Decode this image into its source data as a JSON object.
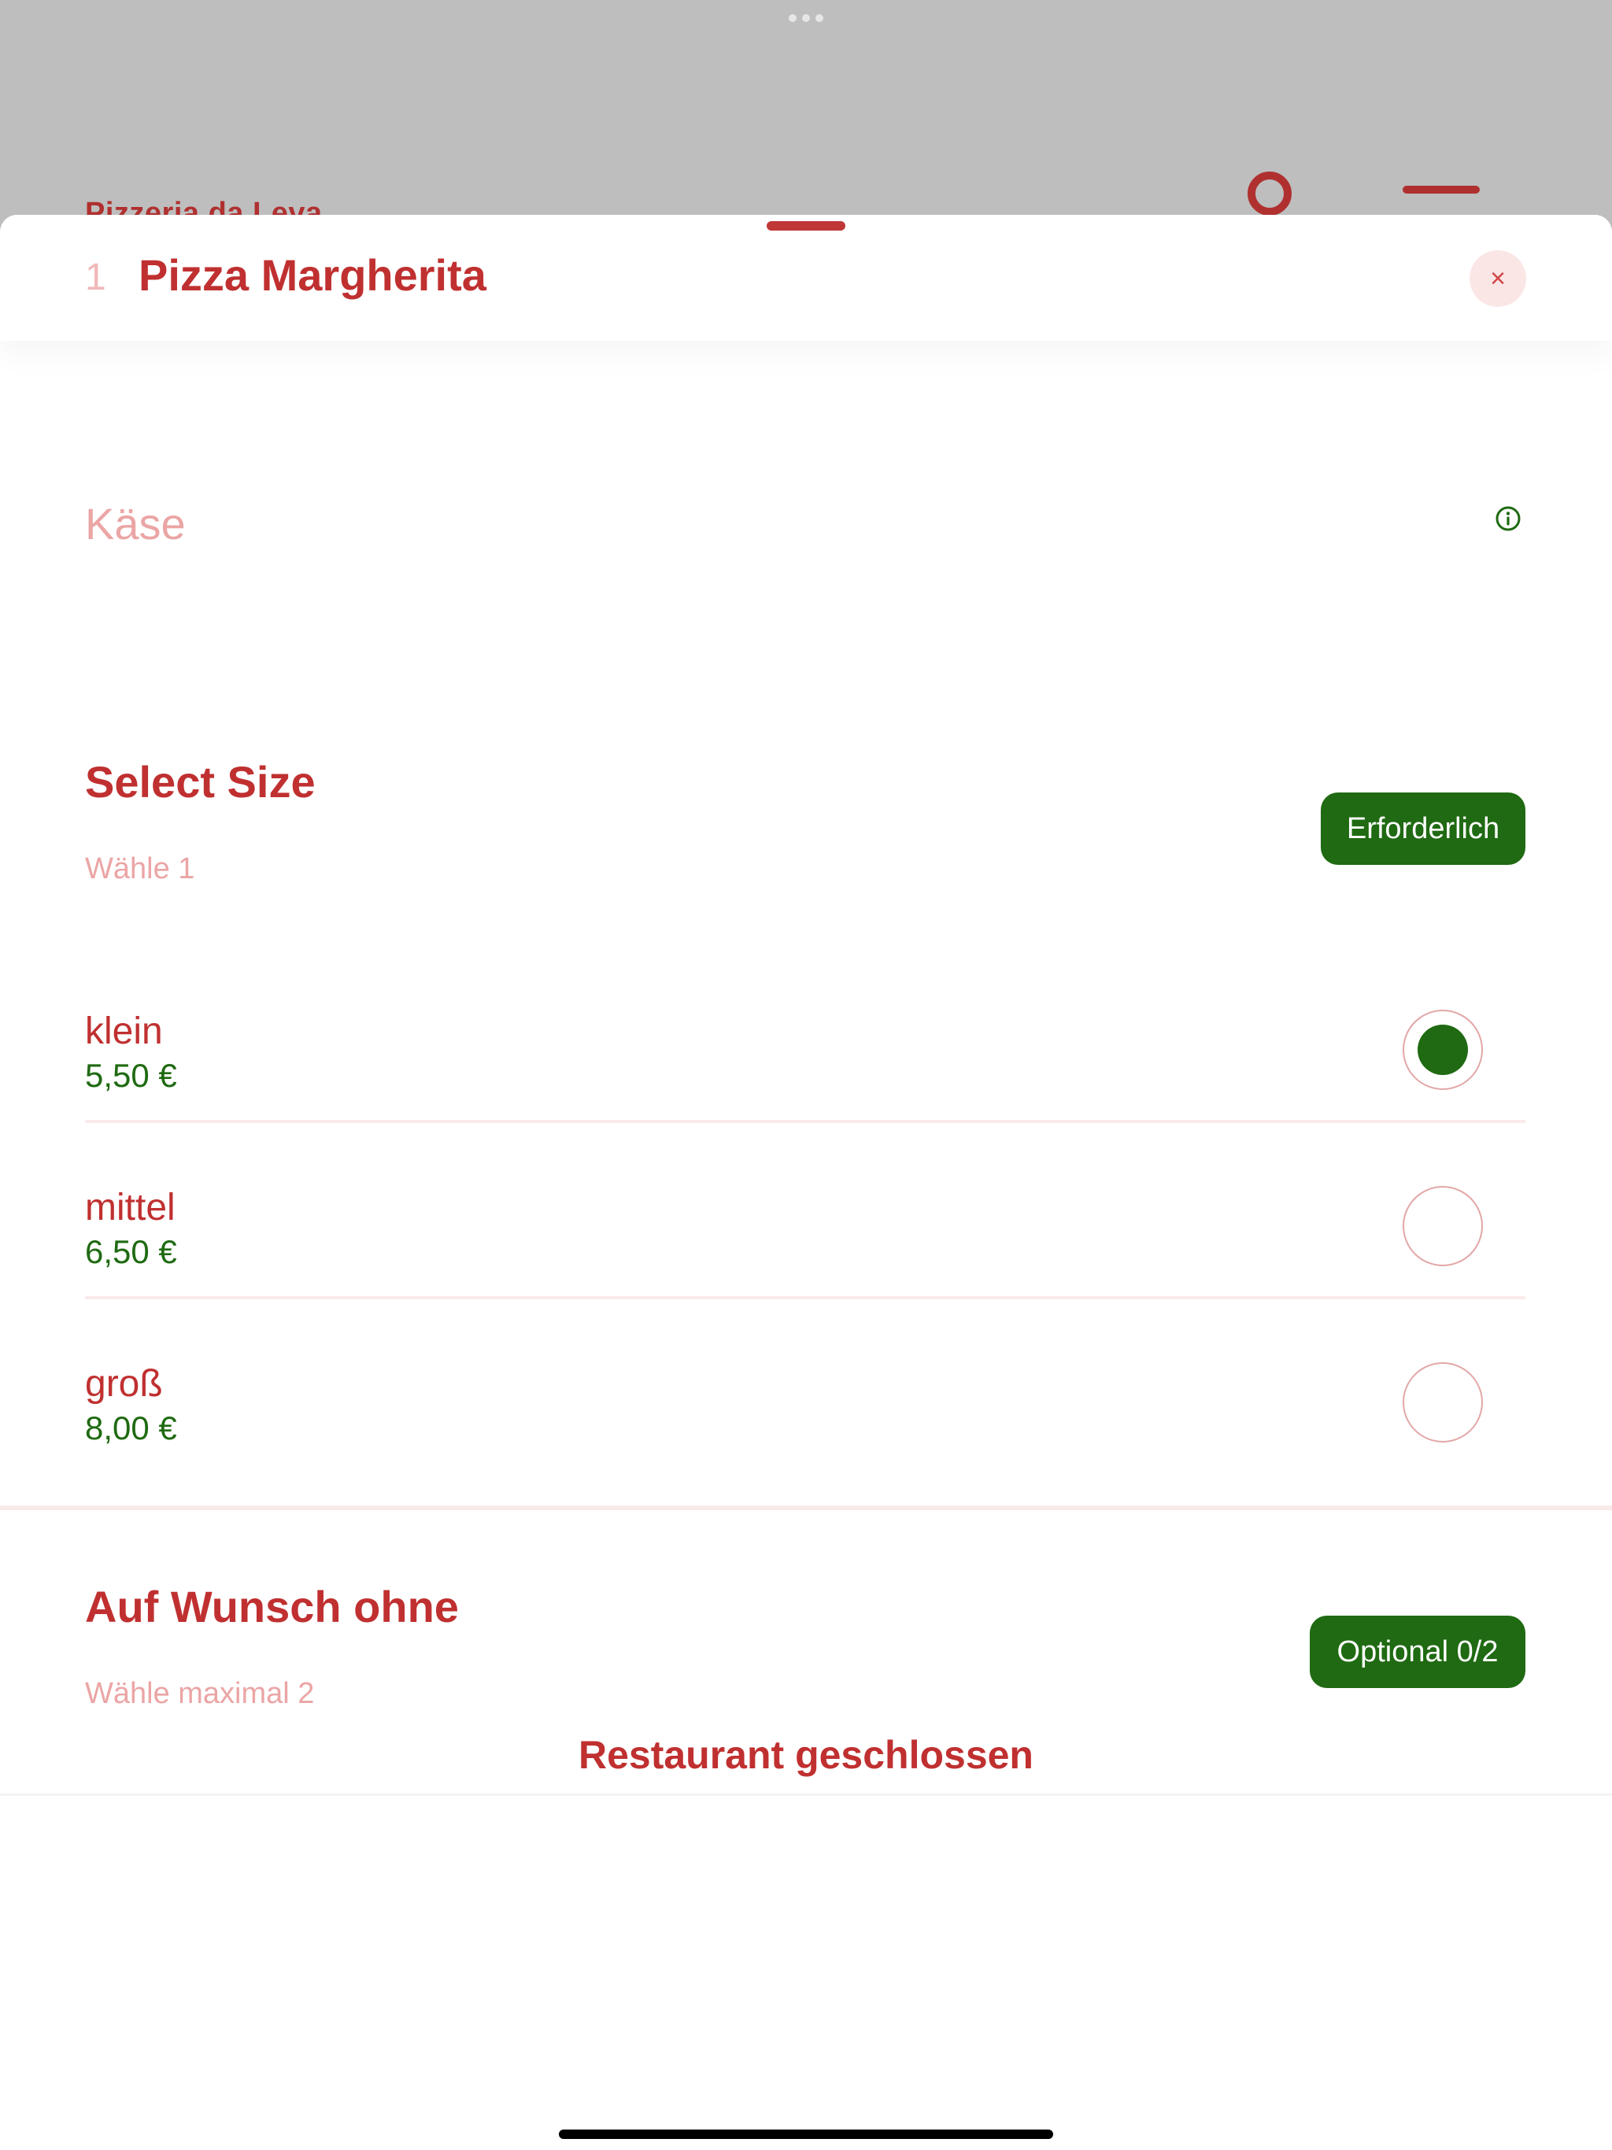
{
  "background": {
    "restaurant_name": "Pizzeria da Leva"
  },
  "header": {
    "item_number": "1",
    "item_title": "Pizza Margherita",
    "close_label": "×"
  },
  "description": "Käse",
  "size_section": {
    "title": "Select Size",
    "subtitle": "Wähle 1",
    "badge": "Erforderlich",
    "options": [
      {
        "name": "klein",
        "price": "5,50 €",
        "selected": true
      },
      {
        "name": "mittel",
        "price": "6,50 €",
        "selected": false
      },
      {
        "name": "groß",
        "price": "8,00 €",
        "selected": false
      }
    ]
  },
  "extras_section": {
    "title": "Auf Wunsch ohne",
    "subtitle": "Wähle maximal 2",
    "badge": "Optional 0/2"
  },
  "footer": {
    "status": "Restaurant geschlossen"
  },
  "colors": {
    "brand_red": "#c03030",
    "accent_green": "#1f6a12",
    "muted_pink": "#eba5a5"
  }
}
